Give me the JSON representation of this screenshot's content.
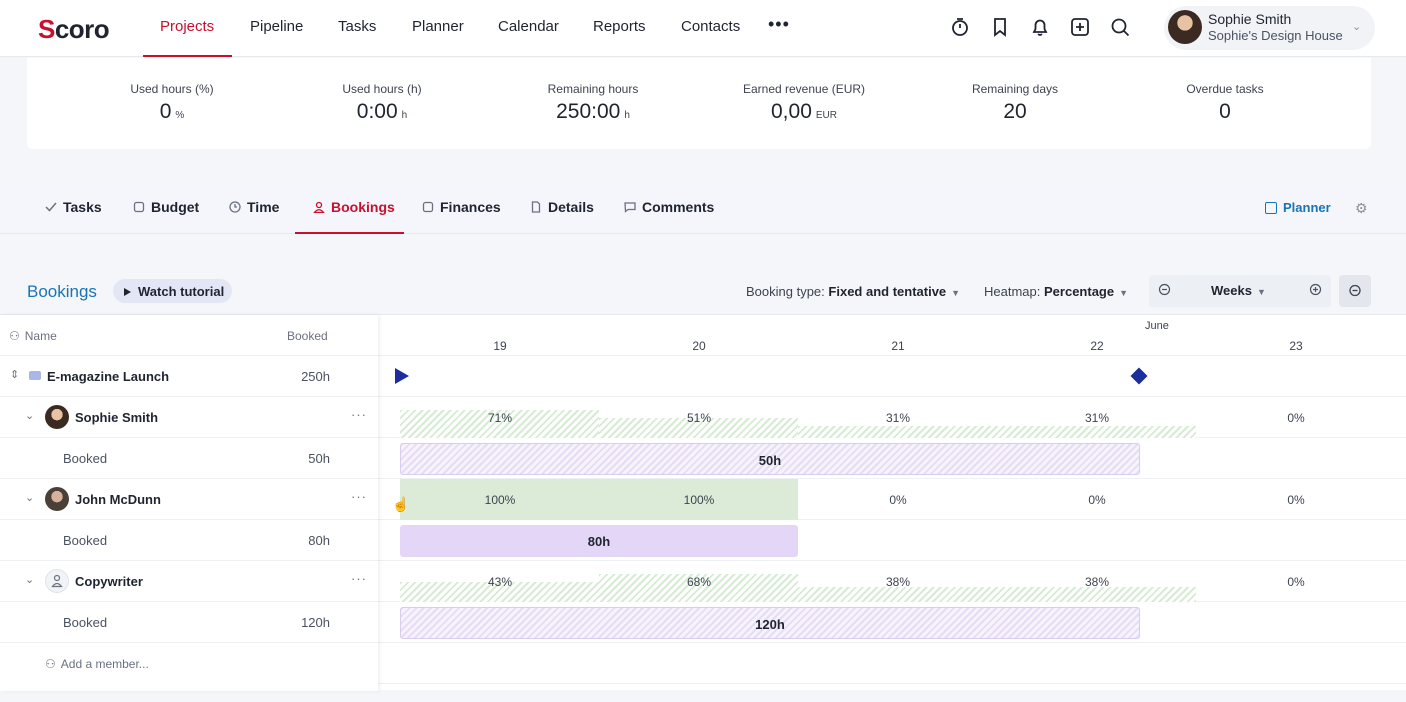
{
  "brand": {
    "logo_text": "Scoro",
    "accent": "#c8102e",
    "link_color": "#1a74b3"
  },
  "topnav": {
    "items": [
      "Projects",
      "Pipeline",
      "Tasks",
      "Planner",
      "Calendar",
      "Reports",
      "Contacts"
    ],
    "active": "Projects",
    "more": "•••",
    "icons": [
      "timer-icon",
      "bookmark-icon",
      "bell-icon",
      "plus-square-icon",
      "search-icon"
    ],
    "user": {
      "name": "Sophie Smith",
      "company": "Sophie's Design House"
    }
  },
  "stats": [
    {
      "label": "Used hours (%)",
      "value": "0",
      "unit": "%"
    },
    {
      "label": "Used hours (h)",
      "value": "0:00",
      "unit": "h"
    },
    {
      "label": "Remaining hours",
      "value": "250:00",
      "unit": "h"
    },
    {
      "label": "Earned revenue (EUR)",
      "value": "0,00",
      "unit": "EUR"
    },
    {
      "label": "Remaining days",
      "value": "20",
      "unit": ""
    },
    {
      "label": "Overdue tasks",
      "value": "0",
      "unit": ""
    }
  ],
  "tabs": {
    "items": [
      "Tasks",
      "Budget",
      "Time",
      "Bookings",
      "Finances",
      "Details",
      "Comments"
    ],
    "active": "Bookings",
    "planner_link": "Planner"
  },
  "bookings": {
    "title": "Bookings",
    "tutorial": "Watch tutorial",
    "booking_type_label": "Booking type:",
    "booking_type_value": "Fixed and tentative",
    "heatmap_label": "Heatmap:",
    "heatmap_value": "Percentage",
    "zoom": "Weeks"
  },
  "grid": {
    "col_name": "Name",
    "col_booked": "Booked",
    "month": "June",
    "weeks": [
      "19",
      "20",
      "21",
      "22",
      "23"
    ],
    "project": {
      "name": "E-magazine Launch",
      "booked": "250h"
    },
    "members": [
      {
        "name": "Sophie Smith",
        "sub_label": "Booked",
        "booked": "50h",
        "heat": [
          "71%",
          "51%",
          "31%",
          "31%",
          "0%"
        ],
        "bar_label": "50h",
        "bar_type": "tentative"
      },
      {
        "name": "John McDunn",
        "sub_label": "Booked",
        "booked": "80h",
        "heat": [
          "100%",
          "100%",
          "0%",
          "0%",
          "0%"
        ],
        "bar_label": "80h",
        "bar_type": "fixed"
      },
      {
        "name": "Copywriter",
        "sub_label": "Booked",
        "booked": "120h",
        "heat": [
          "43%",
          "68%",
          "38%",
          "38%",
          "0%"
        ],
        "bar_label": "120h",
        "bar_type": "tentative"
      }
    ],
    "add_member": "Add a member..."
  }
}
